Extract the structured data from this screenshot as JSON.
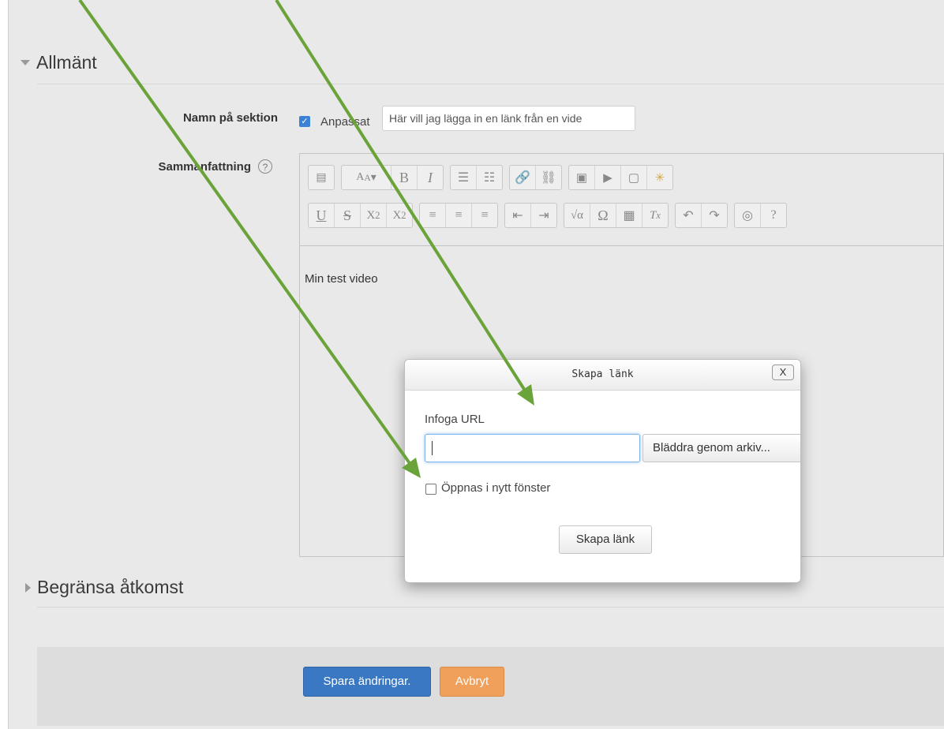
{
  "sections": {
    "general_title": "Allmänt",
    "restrict_title": "Begränsa åtkomst"
  },
  "section_name": {
    "label": "Namn på sektion",
    "custom_label": "Anpassat",
    "custom_checked": true,
    "value": "Här vill jag lägga in en länk från en vide"
  },
  "summary": {
    "label": "Sammanfattning",
    "help_icon": "question-circle-icon",
    "content": "Min test video"
  },
  "toolbar": {
    "row1": [
      [
        "collapse-toolbar-icon"
      ],
      [
        "font-style-icon",
        "bold-icon",
        "italic-icon"
      ],
      [
        "bullet-list-icon",
        "numbered-list-icon"
      ],
      [
        "link-icon",
        "unlink-icon"
      ],
      [
        "image-icon",
        "media-icon",
        "file-manager-icon",
        "emoticon-icon"
      ]
    ],
    "row2": [
      [
        "underline-icon",
        "strikethrough-icon",
        "subscript-icon",
        "superscript-icon"
      ],
      [
        "align-left-icon",
        "align-center-icon",
        "align-right-icon"
      ],
      [
        "outdent-icon",
        "indent-icon"
      ],
      [
        "equation-icon",
        "special-char-icon",
        "table-icon",
        "clear-format-icon"
      ],
      [
        "undo-icon",
        "redo-icon"
      ],
      [
        "accessibility-checker-icon",
        "screen-reader-icon"
      ]
    ]
  },
  "dialog": {
    "title": "Skapa länk",
    "close_label": "X",
    "url_label": "Infoga URL",
    "url_value": "",
    "browse_label": "Bläddra genom arkiv...",
    "new_window_label": "Öppnas i nytt fönster",
    "new_window_checked": false,
    "submit_label": "Skapa länk"
  },
  "footer": {
    "save_label": "Spara ändringar.",
    "cancel_label": "Avbryt"
  },
  "colors": {
    "primary": "#3a78c3",
    "cancel": "#f0a05a",
    "arrow": "#6aa33a",
    "checkbox": "#3b82d6"
  }
}
